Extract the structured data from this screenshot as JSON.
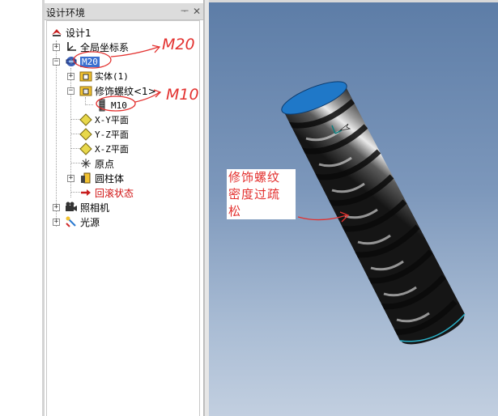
{
  "panel": {
    "title": "设计环境",
    "pin": "ᅮ",
    "close": "✕"
  },
  "tree": {
    "root": "设计1",
    "nodes": [
      {
        "label": "全局坐标系"
      },
      {
        "label": "M20"
      },
      {
        "label": "实体(1)"
      },
      {
        "label": "修饰螺纹<1>"
      },
      {
        "label": "M10"
      },
      {
        "label": "X-Y平面"
      },
      {
        "label": "Y-Z平面"
      },
      {
        "label": "X-Z平面"
      },
      {
        "label": "原点"
      },
      {
        "label": "圆柱体"
      },
      {
        "label": "回滚状态"
      },
      {
        "label": "照相机"
      },
      {
        "label": "光源"
      }
    ]
  },
  "annotations": {
    "m20": "M20",
    "m10": "M10",
    "note_lines": [
      "修饰螺纹",
      "密度过疏",
      "松"
    ]
  },
  "colors": {
    "viewport_top": "#5d7da7",
    "viewport_bottom": "#c2cfe0",
    "annotation": "#e3312f",
    "selection": "#3a6fd0",
    "cylinder_cap": "#1f78c8"
  }
}
